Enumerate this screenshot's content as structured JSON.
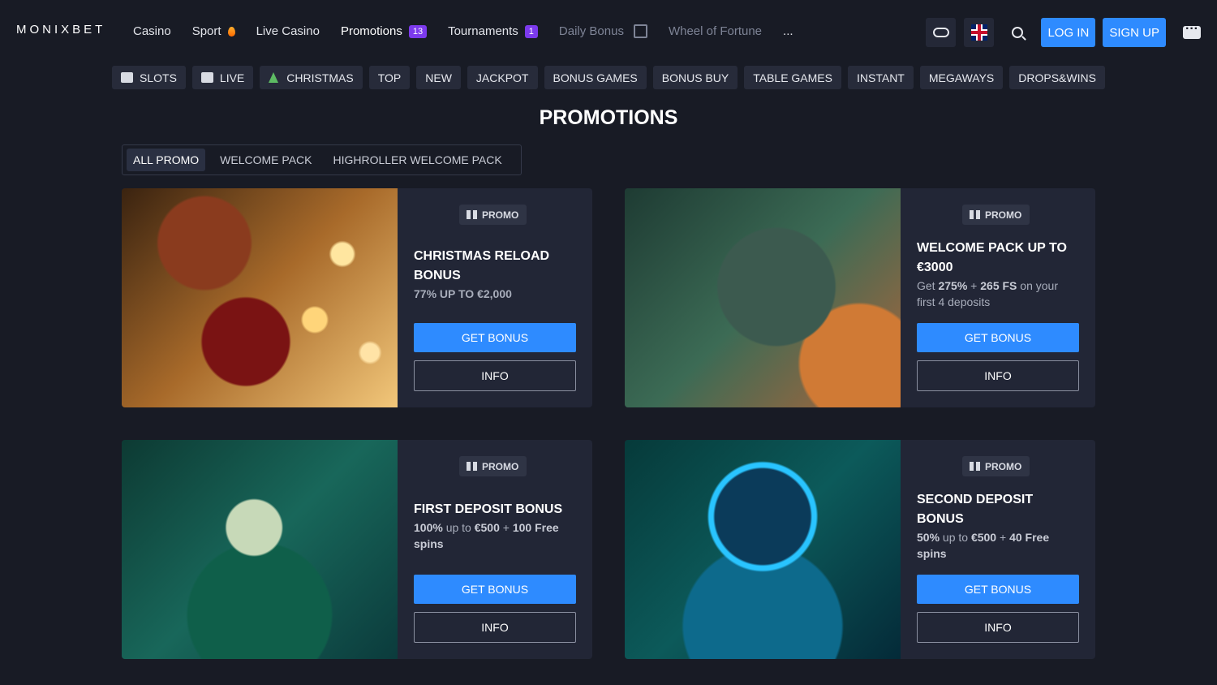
{
  "header": {
    "logo": "MONIXBET",
    "nav": [
      {
        "label": "Casino"
      },
      {
        "label": "Sport"
      },
      {
        "label": "Live Casino"
      },
      {
        "label": "Promotions",
        "badge": "13"
      },
      {
        "label": "Tournaments",
        "badge": "1"
      },
      {
        "label": "Daily Bonus"
      },
      {
        "label": "Wheel of Fortune"
      },
      {
        "label": "..."
      }
    ],
    "login_label": "LOG IN",
    "signup_label": "SIGN UP"
  },
  "categories": [
    "SLOTS",
    "LIVE",
    "CHRISTMAS",
    "TOP",
    "NEW",
    "JACKPOT",
    "BONUS GAMES",
    "BONUS BUY",
    "TABLE GAMES",
    "INSTANT",
    "MEGAWAYS",
    "DROPS&WINS"
  ],
  "page_title": "PROMOTIONS",
  "tabs": [
    "ALL PROMO",
    "WELCOME PACK",
    "HIGHROLLER WELCOME PACK"
  ],
  "promos": [
    {
      "tag": "PROMO",
      "title": "CHRISTMAS RELOAD BONUS",
      "desc": "77% UP TO €2,000",
      "get_label": "GET BONUS",
      "info_label": "INFO"
    },
    {
      "tag": "PROMO",
      "title": "WELCOME PACK UP TO €3000",
      "desc_parts": [
        "Get ",
        "275%",
        " + ",
        "265 FS",
        " on your first 4 deposits"
      ],
      "get_label": "GET BONUS",
      "info_label": "INFO"
    },
    {
      "tag": "PROMO",
      "title": "FIRST DEPOSIT BONUS",
      "desc_parts": [
        "100%",
        " up to ",
        "€500",
        " + ",
        "100 Free spins"
      ],
      "get_label": "GET BONUS",
      "info_label": "INFO"
    },
    {
      "tag": "PROMO",
      "title": "SECOND DEPOSIT BONUS",
      "desc_parts": [
        "50%",
        " up to ",
        "€500",
        " + ",
        "40 Free spins"
      ],
      "get_label": "GET BONUS",
      "info_label": "INFO"
    }
  ],
  "colors": {
    "accent": "#2e8bff",
    "badge": "#7c3aed",
    "bg": "#181b25",
    "card": "#222636"
  }
}
